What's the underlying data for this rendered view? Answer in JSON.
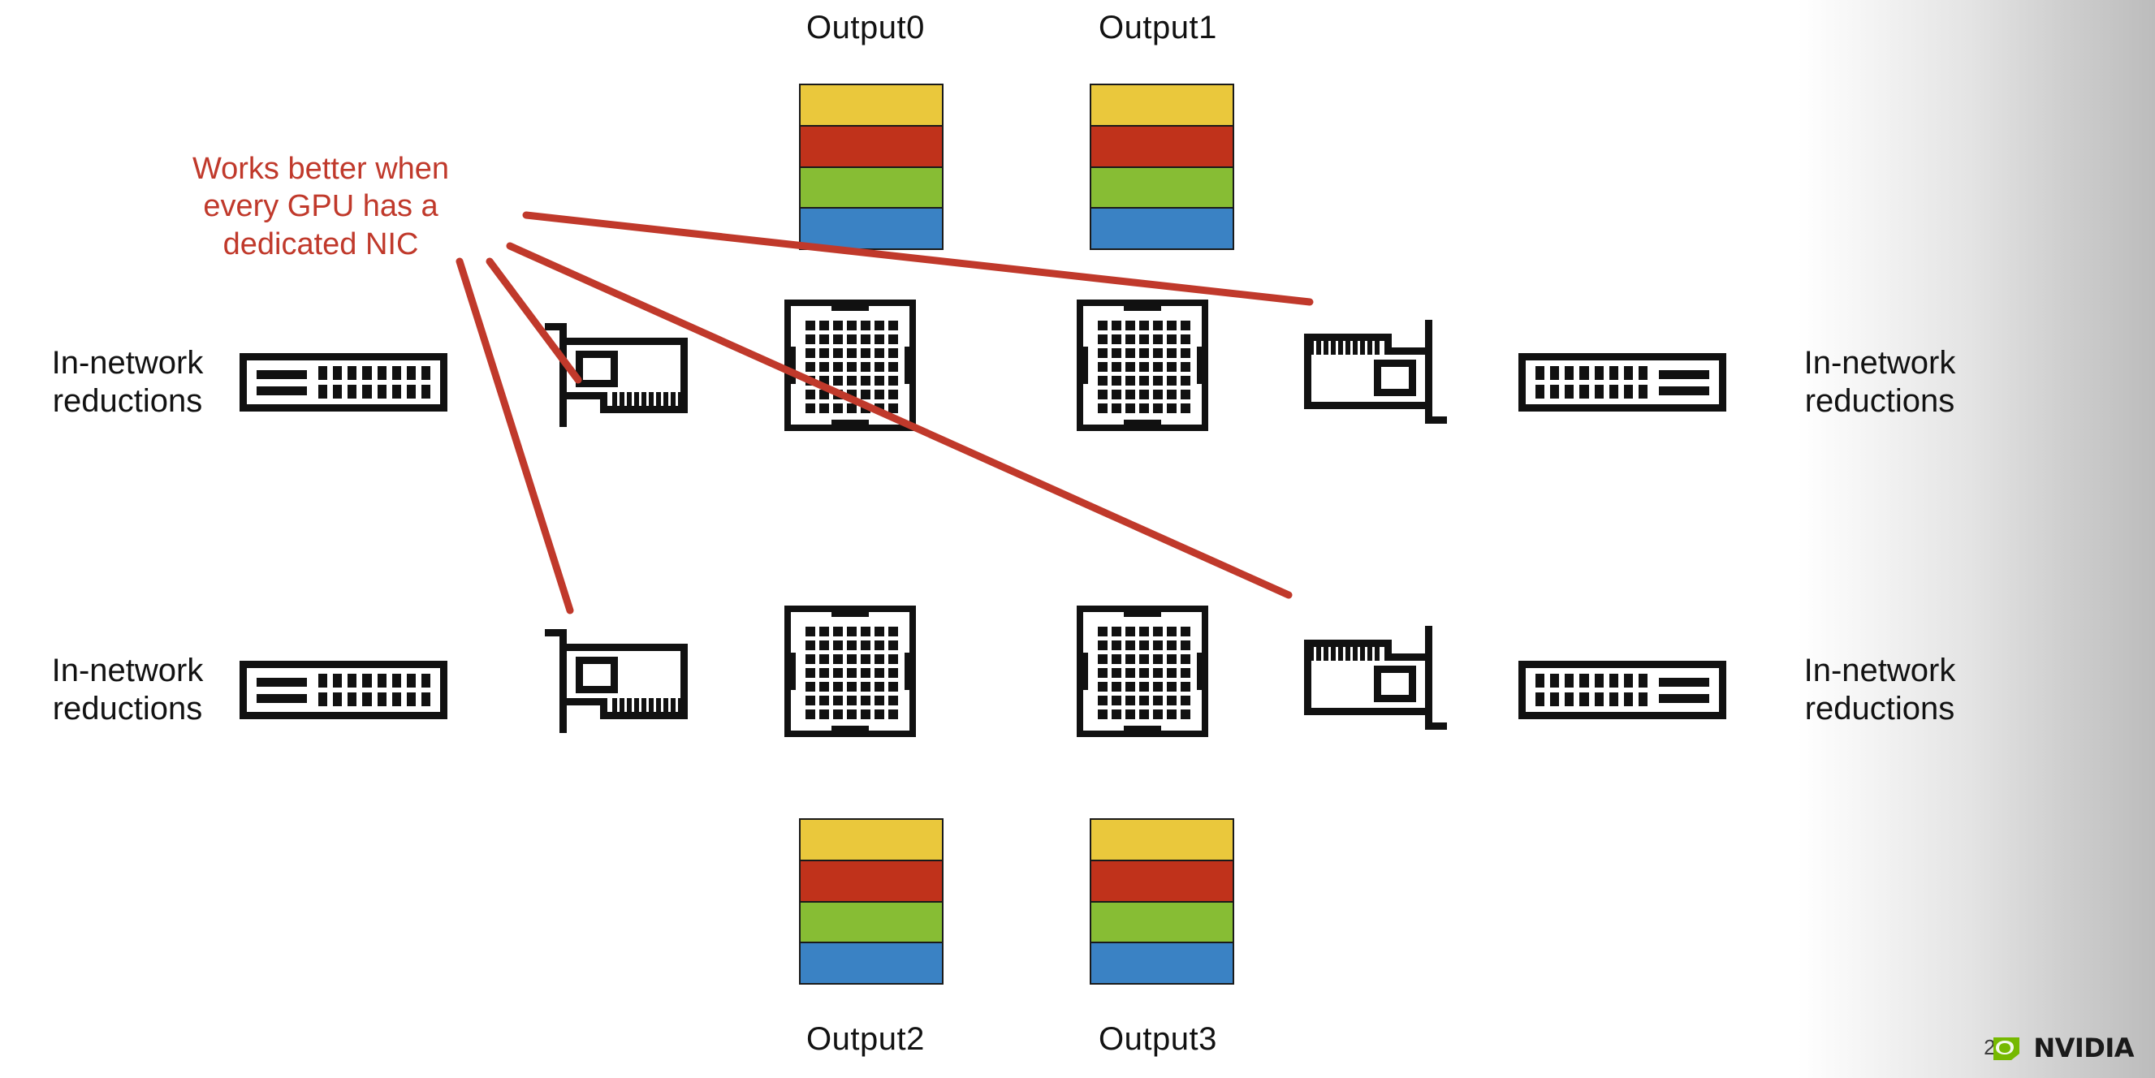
{
  "slide": {
    "page_number": "24",
    "brand": "NVIDIA",
    "background_color": "#ffffff",
    "gradient_end_color": "#bcbcbc"
  },
  "annotation": {
    "color": "#c0392b",
    "line1": "Works better when",
    "line2": "every GPU has a",
    "line3": "dedicated NIC",
    "leader_line_count": 4
  },
  "output_labels": {
    "top_left": "Output0",
    "top_right": "Output1",
    "bottom_left": "Output2",
    "bottom_right": "Output3"
  },
  "side_labels": {
    "top_left_line1": "In-network",
    "top_left_line2": "reductions",
    "top_right_line1": "In-network",
    "top_right_line2": "reductions",
    "bottom_left_line1": "In-network",
    "bottom_left_line2": "reductions",
    "bottom_right_line1": "In-network",
    "bottom_right_line2": "reductions"
  },
  "stack_colors": {
    "band1": "#eac83c",
    "band2": "#c0321b",
    "band3": "#87bd34",
    "band4": "#3a82c4"
  },
  "stack_bands": [
    {
      "name": "gold",
      "color": "#eac83c"
    },
    {
      "name": "red",
      "color": "#c0321b"
    },
    {
      "name": "green",
      "color": "#87bd34"
    },
    {
      "name": "blue",
      "color": "#3a82c4"
    }
  ],
  "icons": {
    "switch": {
      "port_columns": 8,
      "port_rows": 2,
      "indicator_bars": 2
    },
    "nic": {
      "contact_fingers": 11
    },
    "gpu": {
      "pin_grid_columns": 8,
      "pin_grid_rows": 8
    }
  },
  "diagram": {
    "rows": 2,
    "columns_per_row": 6,
    "node_sequence": [
      "switch",
      "nic",
      "gpu",
      "gpu",
      "nic",
      "switch"
    ]
  }
}
